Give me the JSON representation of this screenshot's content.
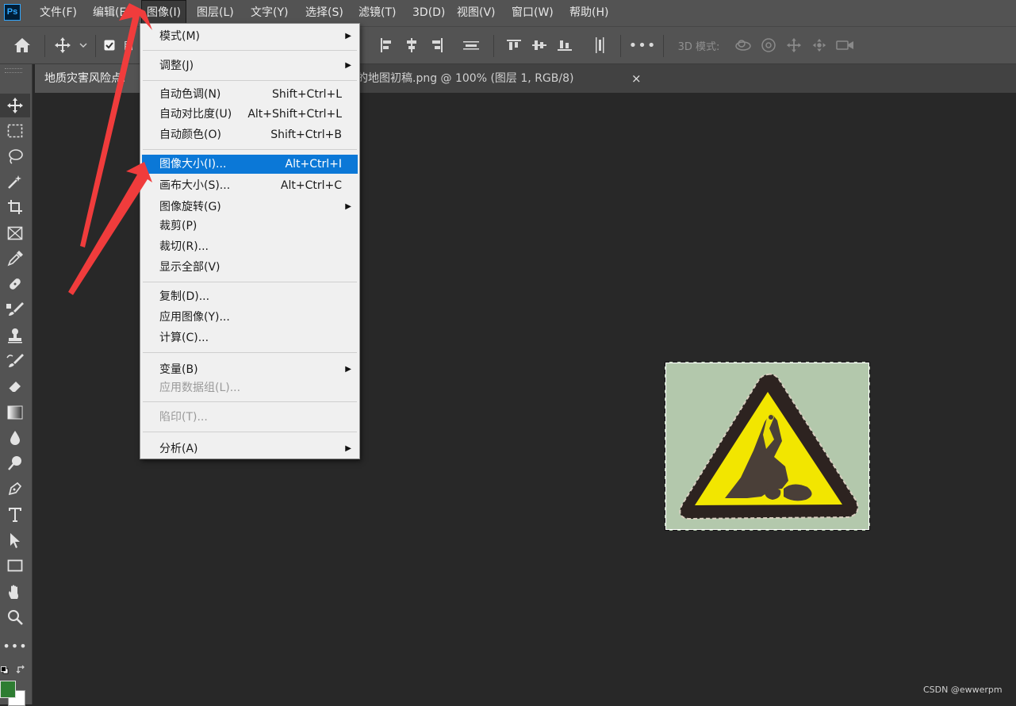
{
  "app": {
    "logo_text": "Ps"
  },
  "menubar": {
    "items": [
      {
        "label": "文件(F)"
      },
      {
        "label": "编辑(E)"
      },
      {
        "label": "图像(I)"
      },
      {
        "label": "图层(L)"
      },
      {
        "label": "文字(Y)"
      },
      {
        "label": "选择(S)"
      },
      {
        "label": "滤镜(T)"
      },
      {
        "label": "3D(D)"
      },
      {
        "label": "视图(V)"
      },
      {
        "label": "窗口(W)"
      },
      {
        "label": "帮助(H)"
      }
    ],
    "active_index": 2
  },
  "options_bar": {
    "auto_select_checked": true,
    "auto_select_label": "自",
    "mode_3d_label": "3D 模式:"
  },
  "tabs": [
    {
      "label": "地质灾害风险点.",
      "active": true
    },
    {
      "label": "的地图初稿.png @ 100% (图层 1, RGB/8)",
      "close": "×",
      "active": false
    }
  ],
  "image_menu": {
    "items": [
      {
        "label": "模式(M)",
        "submenu": true
      },
      {
        "label": "调整(J)",
        "submenu": true
      },
      {
        "label": "自动色调(N)",
        "shortcut": "Shift+Ctrl+L"
      },
      {
        "label": "自动对比度(U)",
        "shortcut": "Alt+Shift+Ctrl+L"
      },
      {
        "label": "自动颜色(O)",
        "shortcut": "Shift+Ctrl+B"
      },
      {
        "label": "图像大小(I)...",
        "shortcut": "Alt+Ctrl+I",
        "highlighted": true
      },
      {
        "label": "画布大小(S)...",
        "shortcut": "Alt+Ctrl+C"
      },
      {
        "label": "图像旋转(G)",
        "submenu": true
      },
      {
        "label": "裁剪(P)"
      },
      {
        "label": "裁切(R)..."
      },
      {
        "label": "显示全部(V)"
      },
      {
        "label": "复制(D)..."
      },
      {
        "label": "应用图像(Y)..."
      },
      {
        "label": "计算(C)..."
      },
      {
        "label": "变量(B)",
        "submenu": true
      },
      {
        "label": "应用数据组(L)...",
        "disabled": true
      },
      {
        "label": "陷印(T)...",
        "disabled": true
      },
      {
        "label": "分析(A)",
        "submenu": true
      }
    ]
  },
  "colors": {
    "foreground": "#2e7d32",
    "background": "#ffffff",
    "menu_highlight": "#0b78d7",
    "annotation_arrow": "#f03c3c",
    "sign_yellow": "#f2e600",
    "sign_border": "#2d2320",
    "canvas_bg": "#b3c8ac"
  },
  "watermark": "CSDN @ewwerpm"
}
